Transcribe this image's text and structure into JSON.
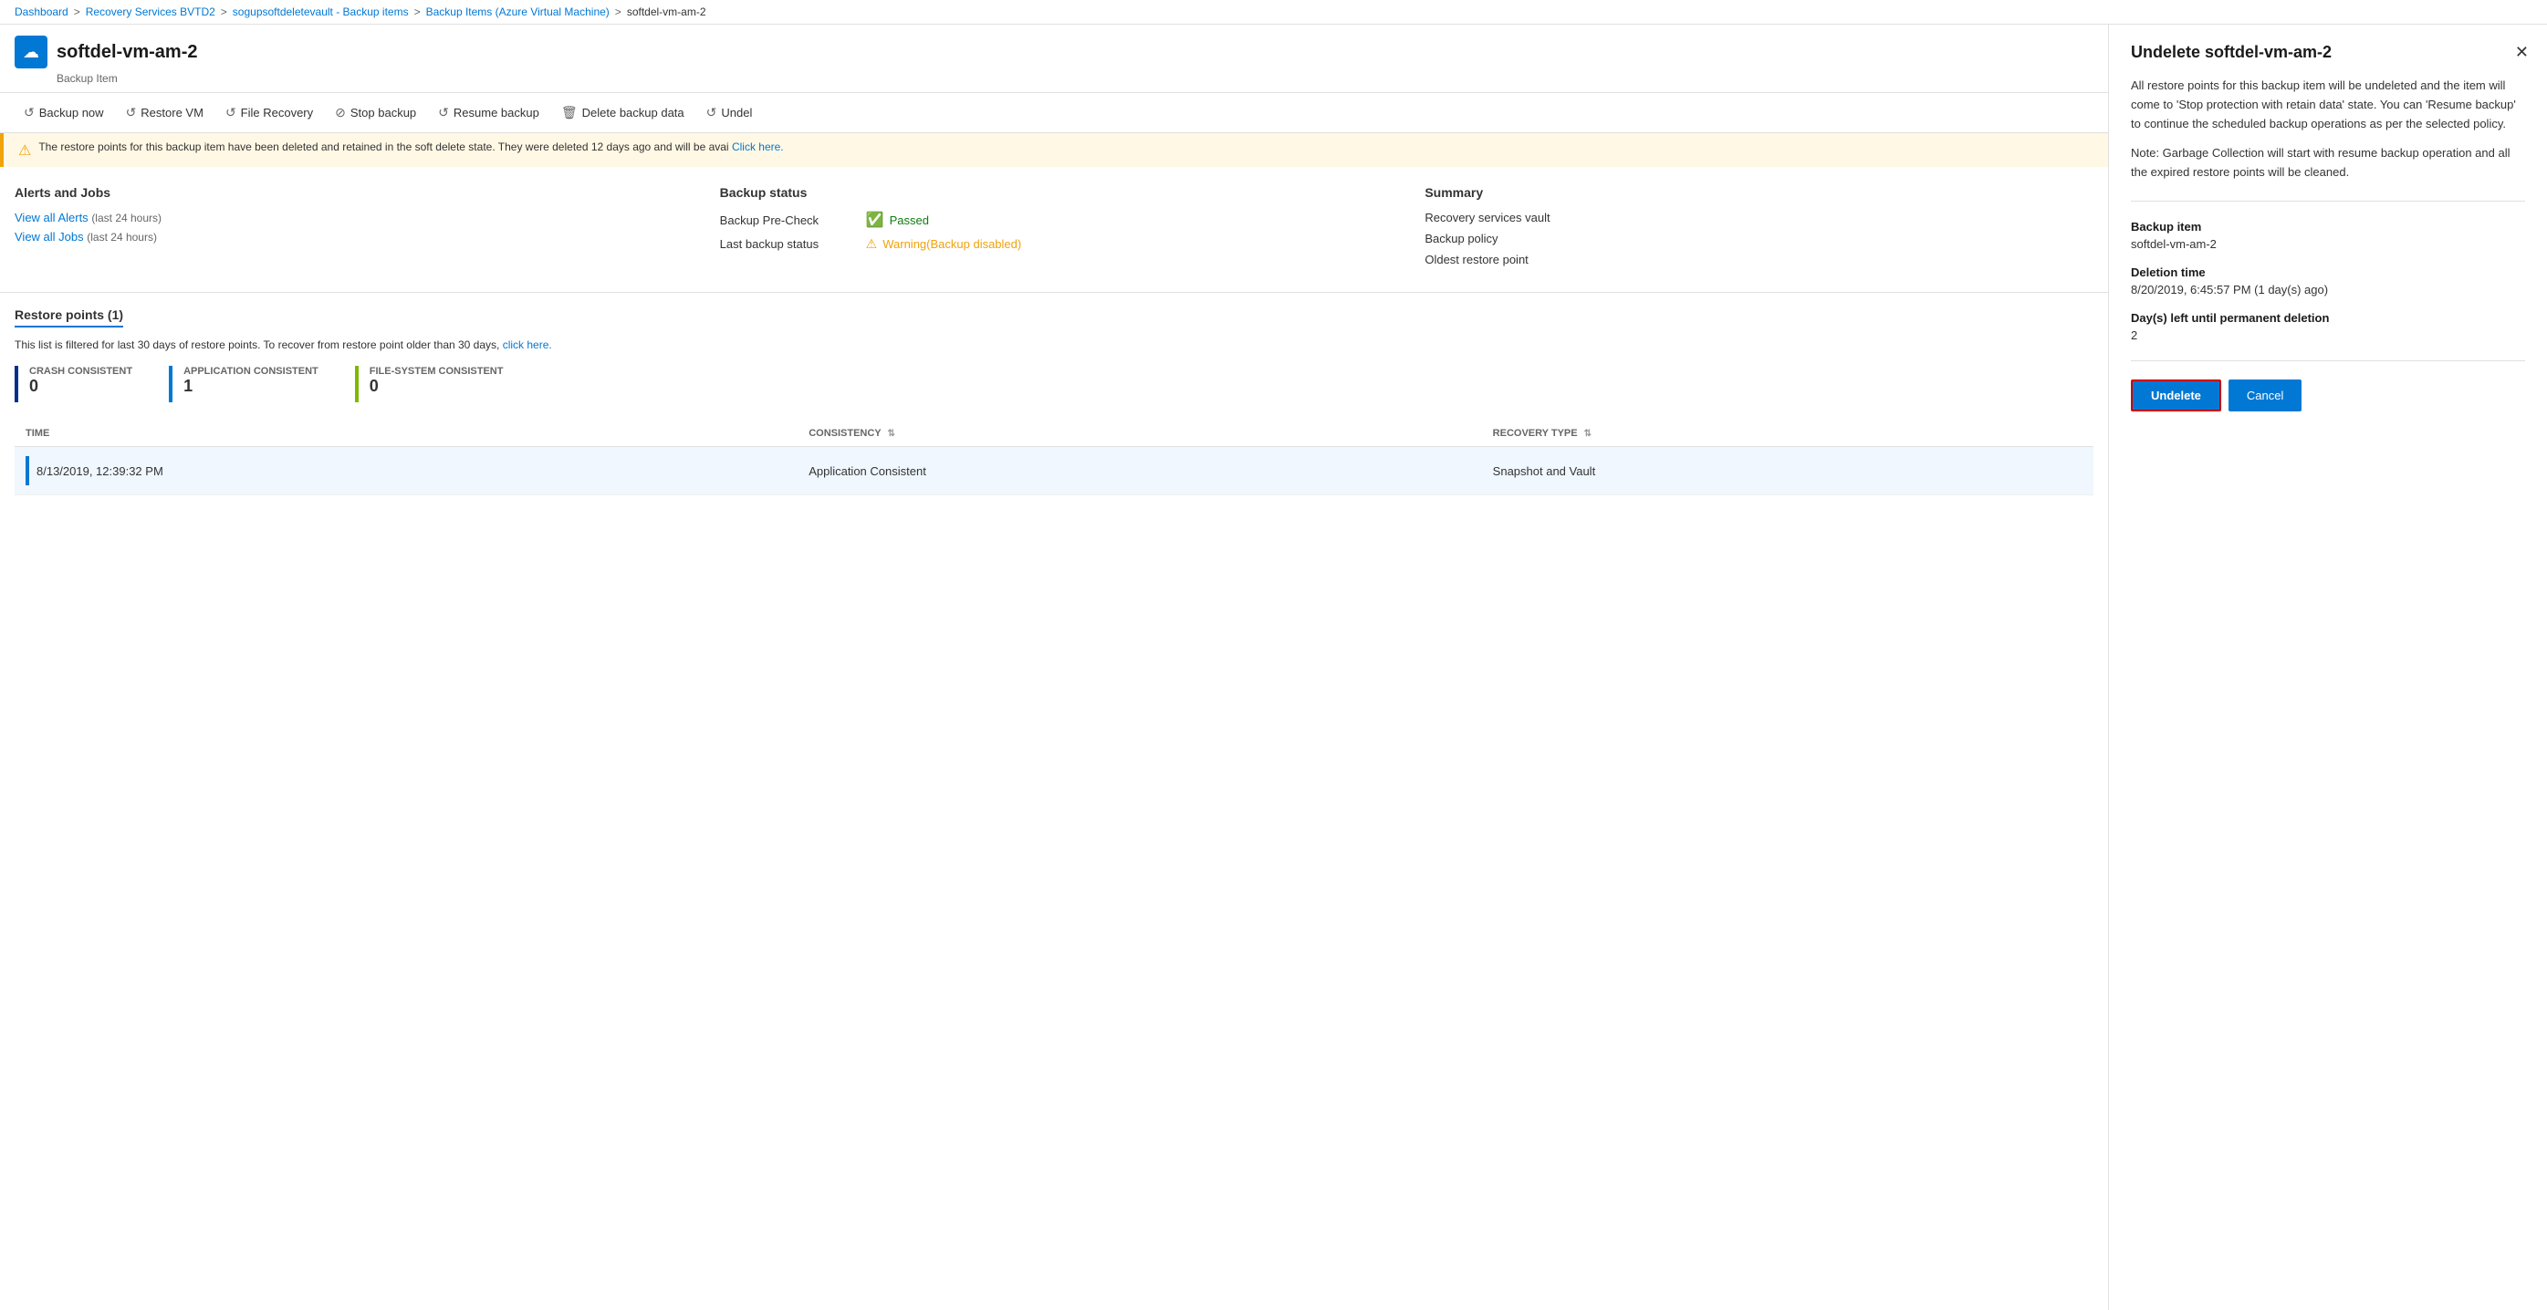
{
  "breadcrumb": {
    "items": [
      {
        "label": "Dashboard",
        "link": true
      },
      {
        "label": "Recovery Services BVTD2",
        "link": true
      },
      {
        "label": "sogupsoftdeletevault - Backup items",
        "link": true
      },
      {
        "label": "Backup Items (Azure Virtual Machine)",
        "link": true
      },
      {
        "label": "softdel-vm-am-2",
        "link": false
      }
    ]
  },
  "header": {
    "icon": "☁",
    "title": "softdel-vm-am-2",
    "subtitle": "Backup Item"
  },
  "toolbar": {
    "buttons": [
      {
        "label": "Backup now",
        "icon": "↺"
      },
      {
        "label": "Restore VM",
        "icon": "↺"
      },
      {
        "label": "File Recovery",
        "icon": "↺"
      },
      {
        "label": "Stop backup",
        "icon": "⊘"
      },
      {
        "label": "Resume backup",
        "icon": "↺"
      },
      {
        "label": "Delete backup data",
        "icon": "🗑"
      },
      {
        "label": "Undel",
        "icon": "↺"
      }
    ]
  },
  "warning": {
    "message": "The restore points for this backup item have been deleted and retained in the soft delete state. They were deleted 12 days ago and will be avai",
    "link_text": "Click here."
  },
  "sections": {
    "alerts": {
      "title": "Alerts and Jobs",
      "links": [
        {
          "label": "View all Alerts",
          "sub": "(last 24 hours)"
        },
        {
          "label": "View all Jobs",
          "sub": "(last 24 hours)"
        }
      ]
    },
    "backup_status": {
      "title": "Backup status",
      "items": [
        {
          "label": "Backup Pre-Check",
          "value": "Passed",
          "type": "passed"
        },
        {
          "label": "Last backup status",
          "value": "Warning(Backup disabled)",
          "type": "warning"
        }
      ]
    },
    "summary": {
      "title": "Summary",
      "items": [
        "Recovery services vault",
        "Backup policy",
        "Oldest restore point"
      ]
    }
  },
  "restore_points": {
    "title": "Restore points (1)",
    "filter_text": "This list is filtered for last 30 days of restore points. To recover from restore point older than 30 days,",
    "filter_link": "click here.",
    "consistency": [
      {
        "label": "CRASH CONSISTENT",
        "count": "0",
        "color": "dark-blue"
      },
      {
        "label": "APPLICATION CONSISTENT",
        "count": "1",
        "color": "blue"
      },
      {
        "label": "FILE-SYSTEM CONSISTENT",
        "count": "0",
        "color": "green"
      }
    ],
    "table": {
      "columns": [
        {
          "label": "TIME",
          "sortable": false
        },
        {
          "label": "CONSISTENCY",
          "sortable": true
        },
        {
          "label": "RECOVERY TYPE",
          "sortable": true
        }
      ],
      "rows": [
        {
          "time": "8/13/2019, 12:39:32 PM",
          "consistency": "Application Consistent",
          "recovery_type": "Snapshot and Vault"
        }
      ]
    }
  },
  "panel": {
    "title": "Undelete softdel-vm-am-2",
    "description1": "All restore points for this backup item will be undeleted and the item will come to 'Stop protection with retain data' state. You can 'Resume backup' to continue the scheduled backup operations as per the selected policy.",
    "description2": "Note: Garbage Collection will start with resume backup operation and all the expired restore points will be cleaned.",
    "fields": [
      {
        "label": "Backup item",
        "value": "softdel-vm-am-2"
      },
      {
        "label": "Deletion time",
        "value": "8/20/2019, 6:45:57 PM (1 day(s) ago)"
      },
      {
        "label": "Day(s) left until permanent deletion",
        "value": "2"
      }
    ],
    "buttons": {
      "undelete": "Undelete",
      "cancel": "Cancel"
    }
  }
}
